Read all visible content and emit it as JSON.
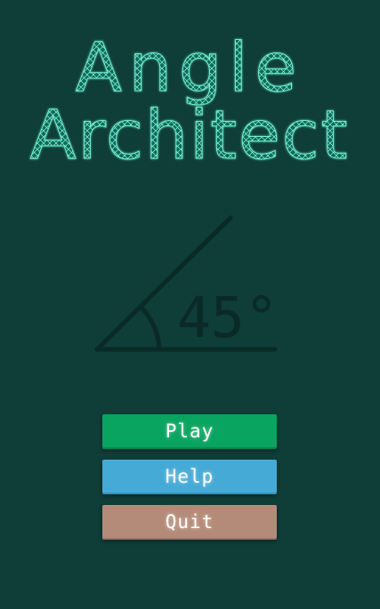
{
  "title": {
    "line1": "Angle",
    "line2": "Architect"
  },
  "emblem": {
    "angle_label": "45°"
  },
  "menu": {
    "play_label": "Play",
    "help_label": "Help",
    "quit_label": "Quit"
  },
  "colors": {
    "background": "#0f3d38",
    "title_glow": "#3fd9b3",
    "emblem": "#0a2a26",
    "play": "#09a45f",
    "help": "#46aad6",
    "quit": "#b48b78"
  }
}
